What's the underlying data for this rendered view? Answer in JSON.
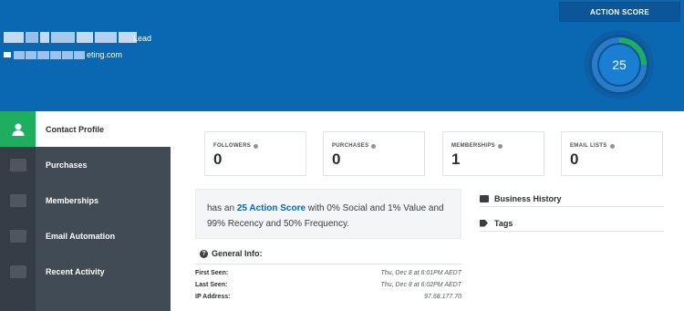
{
  "header": {
    "lead_label": "Lead",
    "email_suffix": "eting.com",
    "action_score_label": "ACTION SCORE",
    "action_score_value": "25",
    "action_score_fraction": 0.25,
    "colors": {
      "banner": "#0a67b2",
      "gauge_fill": "#1fae5f"
    }
  },
  "sidebar": {
    "items": [
      {
        "label": "Contact Profile",
        "icon": "user-icon",
        "active": true
      },
      {
        "label": "Purchases",
        "icon": "cart-icon",
        "active": false
      },
      {
        "label": "Memberships",
        "icon": "graduation-cap-icon",
        "active": false
      },
      {
        "label": "Email Automation",
        "icon": "envelope-icon",
        "active": false
      },
      {
        "label": "Recent Activity",
        "icon": "money-icon",
        "active": false
      }
    ]
  },
  "stats": [
    {
      "label": "FOLLOWERS",
      "value": "0"
    },
    {
      "label": "PURCHASES",
      "value": "0"
    },
    {
      "label": "MEMBERSHIPS",
      "value": "1"
    },
    {
      "label": "EMAIL LISTS",
      "value": "0"
    }
  ],
  "summary": {
    "prefix": "has an ",
    "score_text": "25 Action Score",
    "suffix": " with 0% Social and 1% Value and 99% Recency and 50% Frequency."
  },
  "general_info": {
    "title": "General Info:",
    "rows": [
      {
        "key": "First Seen:",
        "value": "Thu, Dec 8 at 6:01PM AEDT"
      },
      {
        "key": "Last Seen:",
        "value": "Thu, Dec 8 at 6:02PM AEDT"
      },
      {
        "key": "IP Address:",
        "value": "97.68.177.70"
      }
    ]
  },
  "panels": {
    "business_history": "Business History",
    "tags": "Tags"
  }
}
